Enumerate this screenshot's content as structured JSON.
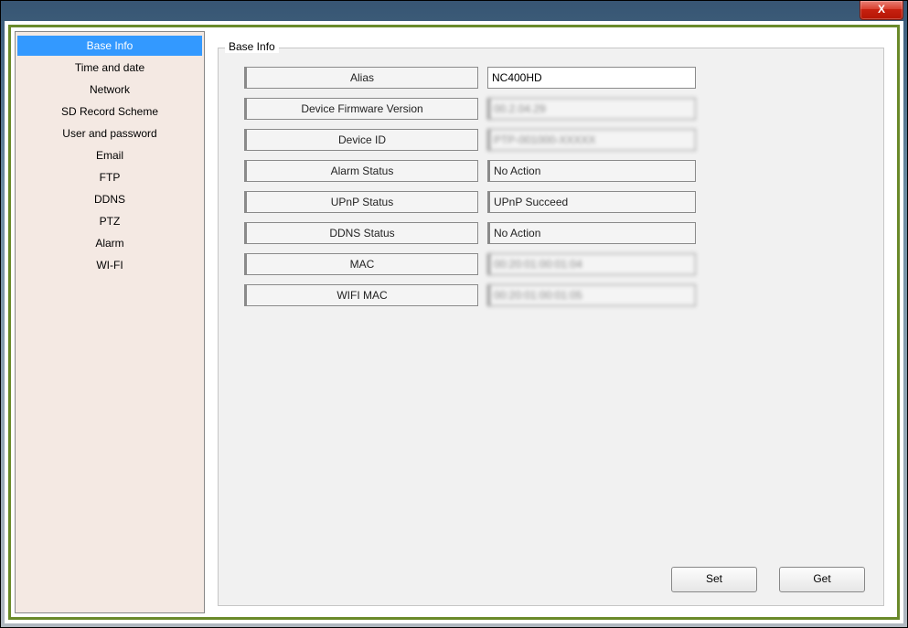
{
  "titlebar": {
    "close_label": "X"
  },
  "sidebar": {
    "items": [
      {
        "label": "Base Info",
        "active": true
      },
      {
        "label": "Time and date",
        "active": false
      },
      {
        "label": "Network",
        "active": false
      },
      {
        "label": "SD Record Scheme",
        "active": false
      },
      {
        "label": "User and password",
        "active": false
      },
      {
        "label": "Email",
        "active": false
      },
      {
        "label": "FTP",
        "active": false
      },
      {
        "label": "DDNS",
        "active": false
      },
      {
        "label": "PTZ",
        "active": false
      },
      {
        "label": "Alarm",
        "active": false
      },
      {
        "label": "WI-FI",
        "active": false
      }
    ]
  },
  "panel": {
    "title": "Base Info",
    "rows": {
      "alias": {
        "label": "Alias",
        "value": "NC400HD"
      },
      "firmware": {
        "label": "Device Firmware Version",
        "value": "00.2.04.29"
      },
      "deviceid": {
        "label": "Device ID",
        "value": "PTP-001000-XXXXX"
      },
      "alarm": {
        "label": "Alarm Status",
        "value": "No Action"
      },
      "upnp": {
        "label": "UPnP Status",
        "value": "UPnP Succeed"
      },
      "ddns": {
        "label": "DDNS Status",
        "value": "No Action"
      },
      "mac": {
        "label": "MAC",
        "value": "00:20:01:00:01:04"
      },
      "wifimac": {
        "label": "WIFI MAC",
        "value": "00:20:01:00:01:05"
      }
    },
    "buttons": {
      "set": "Set",
      "get": "Get"
    }
  }
}
